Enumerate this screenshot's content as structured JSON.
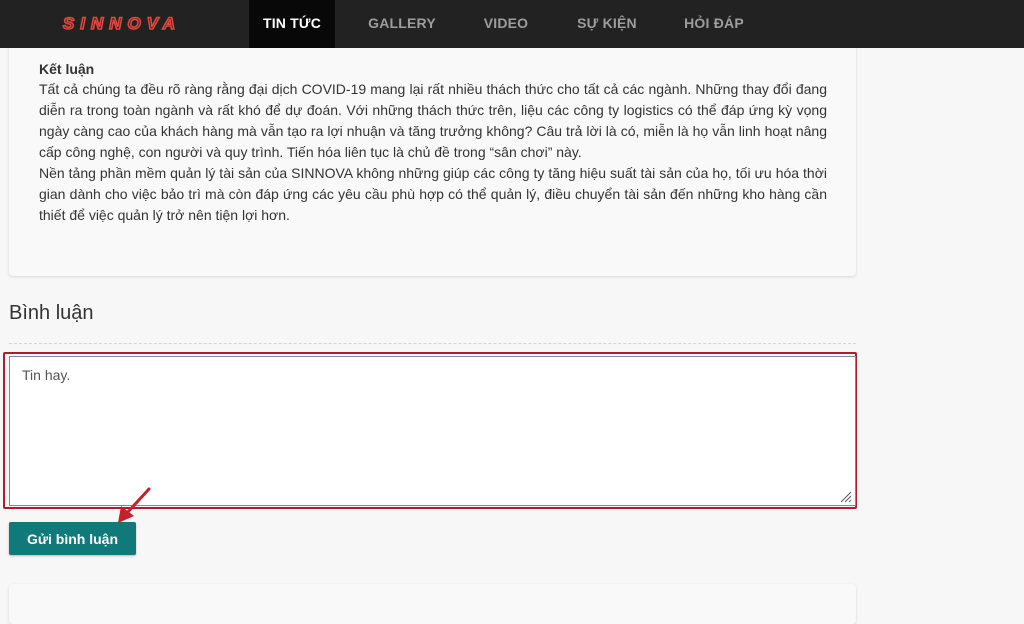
{
  "header": {
    "logo_text": "SINNOVA",
    "nav": [
      {
        "label": "TIN TỨC",
        "active": true
      },
      {
        "label": "GALLERY",
        "active": false
      },
      {
        "label": "VIDEO",
        "active": false
      },
      {
        "label": "SỰ KIỆN",
        "active": false
      },
      {
        "label": "HỎI ĐÁP",
        "active": false
      }
    ]
  },
  "article": {
    "heading": "Kết luận",
    "paragraphs": [
      "Tất cả chúng ta đều rõ ràng rằng đại dịch COVID-19 mang lại rất nhiều thách thức cho tất cả các ngành. Những thay đổi đang diễn ra trong toàn ngành và rất khó để dự đoán. Với những thách thức trên, liệu các công ty logistics có thể đáp ứng kỳ vọng ngày càng cao của khách hàng mà vẫn tạo ra lợi nhuận và tăng trưởng không? Câu trả lời là có, miễn là họ vẫn linh hoạt nâng cấp công nghệ, con người và quy trình. Tiến hóa liên tục là chủ đề trong “sân chơi” này.",
      "Nền tảng phần mềm quản lý tài sản của SINNOVA không những giúp các công ty tăng hiệu suất tài sản của họ, tối ưu hóa thời gian dành cho việc bảo trì mà còn đáp ứng các yêu cầu phù hợp có thể quản lý, điều chuyển tài sản đến những kho hàng cần thiết để việc quản lý trở nên tiện lợi hơn."
    ]
  },
  "comments": {
    "title": "Bình luận",
    "input_value": "Tin hay.",
    "submit_label": "Gửi bình luận"
  },
  "colors": {
    "navbar": "#222222",
    "nav_active_bg": "#080808",
    "logo": "#e0463e",
    "submit_button": "#10797a",
    "highlight": "#b01c2e"
  },
  "icons": {
    "annotation": "red-arrow-icon",
    "resize": "resize-grip-icon"
  }
}
